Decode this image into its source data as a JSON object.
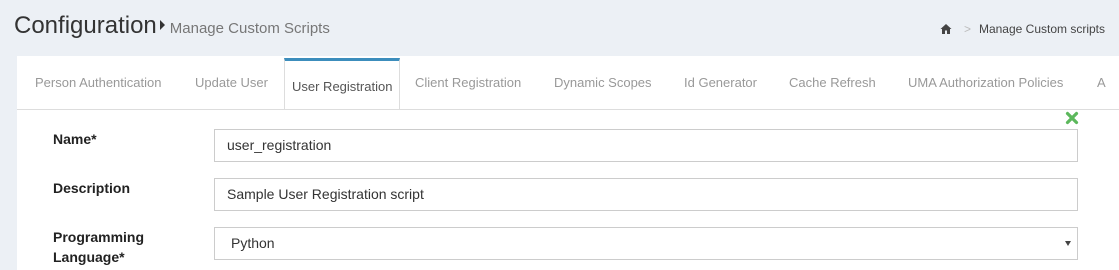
{
  "header": {
    "title": "Configuration",
    "subtitle": "Manage Custom Scripts"
  },
  "breadcrumb": {
    "home_icon": "home-icon",
    "separator": ">",
    "current": "Manage Custom scripts"
  },
  "tabs": [
    {
      "label": "Person Authentication",
      "active": false
    },
    {
      "label": "Update User",
      "active": false
    },
    {
      "label": "User Registration",
      "active": true
    },
    {
      "label": "Client Registration",
      "active": false
    },
    {
      "label": "Dynamic Scopes",
      "active": false
    },
    {
      "label": "Id Generator",
      "active": false
    },
    {
      "label": "Cache Refresh",
      "active": false
    },
    {
      "label": "UMA Authorization Policies",
      "active": false
    },
    {
      "label": "A",
      "active": false
    }
  ],
  "form": {
    "remove_icon": "close-icon",
    "remove_color": "#5cb85c",
    "name_label": "Name*",
    "name_value": "user_registration",
    "description_label": "Description",
    "description_value": "Sample User Registration script",
    "language_label_line1": "Programming",
    "language_label_line2": "Language*",
    "language_value": "Python"
  },
  "colors": {
    "page_bg": "#ecf0f5",
    "active_tab_accent": "#3c8dbc"
  }
}
